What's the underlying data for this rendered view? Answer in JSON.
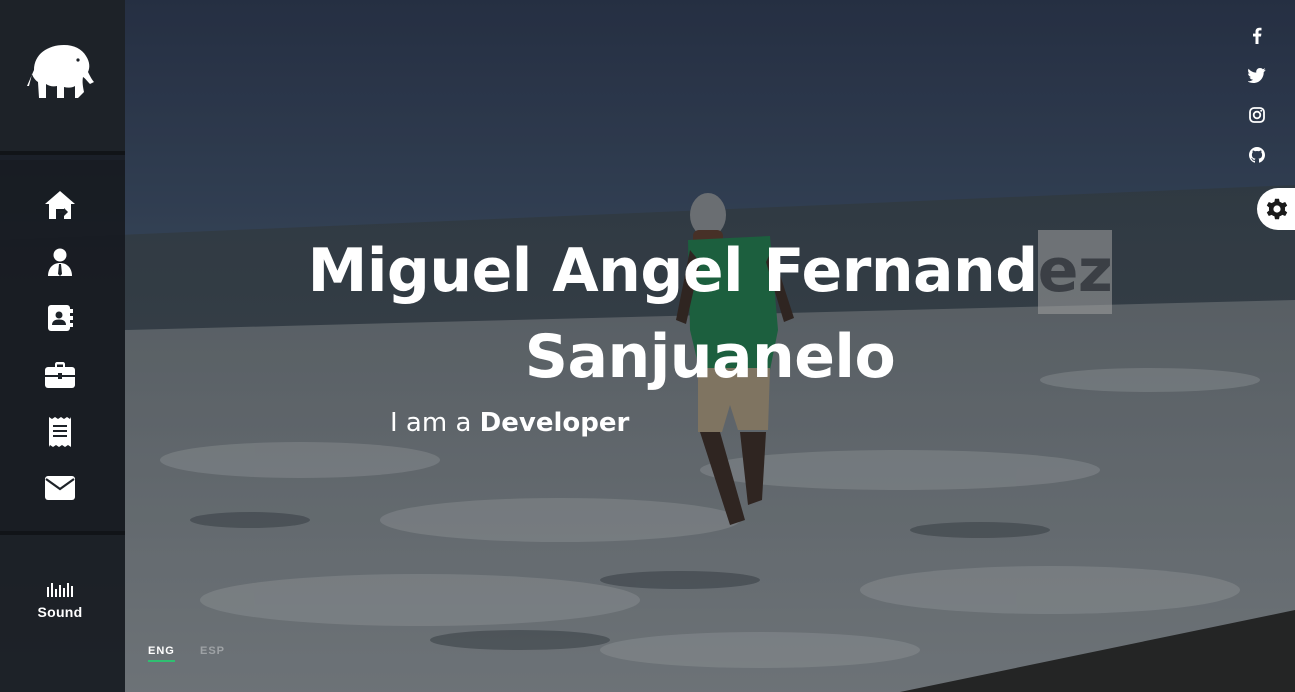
{
  "hero": {
    "title_main": "Miguel Angel Fernand",
    "title_highlight": "ez",
    "title_line2": "Sanjuanelo",
    "subtitle_prefix": "I am a",
    "subtitle_role": "Developer"
  },
  "sidebar": {
    "logo_icon": "elephant-logo",
    "nav_items": [
      {
        "icon": "home-icon"
      },
      {
        "icon": "user-icon"
      },
      {
        "icon": "contact-card-icon"
      },
      {
        "icon": "briefcase-icon"
      },
      {
        "icon": "receipt-icon"
      },
      {
        "icon": "envelope-icon"
      }
    ],
    "sound_label": "Sound"
  },
  "language": {
    "active": "ENG",
    "inactive": "ESP",
    "accent_color": "#2fbf71"
  },
  "social": [
    "facebook-icon",
    "twitter-icon",
    "instagram-icon",
    "github-icon"
  ],
  "settings_icon": "gear-icon"
}
